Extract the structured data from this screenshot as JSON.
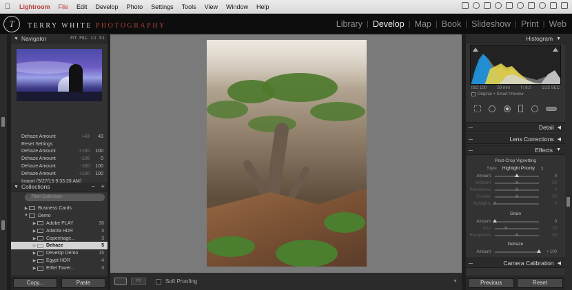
{
  "menubar": {
    "apple": "",
    "app": "Lightroom",
    "items": [
      "File",
      "Edit",
      "Develop",
      "Photo",
      "Settings",
      "Tools",
      "View",
      "Window",
      "Help"
    ]
  },
  "identity": {
    "logo": "T",
    "studio_name": "TERRY WHITE ",
    "studio_accent": "PHOTOGRAPHY"
  },
  "modules": [
    "Library",
    "Develop",
    "Map",
    "Book",
    "Slideshow",
    "Print",
    "Web"
  ],
  "active_module": "Develop",
  "navigator": {
    "title": "Navigator",
    "zoom_options": [
      "FIT",
      "FILL",
      "1:1",
      "3:1"
    ]
  },
  "history": [
    {
      "name": "Dehaze Amount",
      "a": "+43",
      "b": "43"
    },
    {
      "name": "Reset Settings",
      "a": "",
      "b": ""
    },
    {
      "name": "Dehaze Amount",
      "a": "+100",
      "b": "100"
    },
    {
      "name": "Dehaze Amount",
      "a": "-100",
      "b": "0"
    },
    {
      "name": "Dehaze Amount",
      "a": "-100",
      "b": "100"
    },
    {
      "name": "Dehaze Amount",
      "a": "+100",
      "b": "100"
    },
    {
      "name": "Import (5/27/15 9:33:28 AM)",
      "a": "",
      "b": ""
    }
  ],
  "collections": {
    "title": "Collections",
    "minus": "−",
    "plus": "+",
    "filter_placeholder": "Filter Collections",
    "items": [
      {
        "indent": 1,
        "name": "Business Cards",
        "count": "",
        "expanded": false,
        "selected": false
      },
      {
        "indent": 1,
        "name": "Demo",
        "count": "",
        "expanded": true,
        "selected": false
      },
      {
        "indent": 2,
        "name": "Adobe PLAY",
        "count": "36",
        "expanded": false,
        "selected": false
      },
      {
        "indent": 2,
        "name": "Atlanta HDR",
        "count": "3",
        "expanded": false,
        "selected": false
      },
      {
        "indent": 2,
        "name": "Copenhage...",
        "count": "3",
        "expanded": false,
        "selected": false
      },
      {
        "indent": 2,
        "name": "Dehaze",
        "count": "5",
        "expanded": false,
        "selected": true
      },
      {
        "indent": 2,
        "name": "Develop Demo",
        "count": "15",
        "expanded": false,
        "selected": false
      },
      {
        "indent": 2,
        "name": "Egypt HDR",
        "count": "4",
        "expanded": false,
        "selected": false
      },
      {
        "indent": 2,
        "name": "Eiffel Tower...",
        "count": "3",
        "expanded": false,
        "selected": false
      }
    ]
  },
  "left_buttons": {
    "copy": "Copy...",
    "paste": "Paste"
  },
  "toolbar": {
    "view_mode": "YY",
    "soft_proofing": "Soft Proofing"
  },
  "histogram": {
    "title": "Histogram",
    "iso": "ISO 100",
    "focal": "50 mm",
    "aperture": "f / 8.0",
    "shutter": "1/25 SEC",
    "preview": "Original + Smart Preview"
  },
  "sections": {
    "detail": "Detail",
    "lens": "Lens Corrections",
    "effects": "Effects",
    "camera": "Camera Calibration"
  },
  "effects": {
    "vignette_title": "Post-Crop Vignetting",
    "style_label": "Style",
    "style_value": "Highlight Priority",
    "vignette_sliders": [
      {
        "label": "Amount",
        "value": "0",
        "fraction": 0.5,
        "dim": false
      },
      {
        "label": "Midpoint",
        "value": "50",
        "fraction": 0.5,
        "dim": true
      },
      {
        "label": "Roundness",
        "value": "0",
        "fraction": 0.5,
        "dim": true
      },
      {
        "label": "Feather",
        "value": "50",
        "fraction": 0.5,
        "dim": true
      },
      {
        "label": "Highlights",
        "value": "0",
        "fraction": 0.0,
        "dim": true
      }
    ],
    "grain_title": "Grain",
    "grain_sliders": [
      {
        "label": "Amount",
        "value": "0",
        "fraction": 0.0,
        "dim": false
      },
      {
        "label": "Size",
        "value": "25",
        "fraction": 0.25,
        "dim": true
      },
      {
        "label": "Roughness",
        "value": "50",
        "fraction": 0.5,
        "dim": true
      }
    ],
    "dehaze_title": "Dehaze",
    "dehaze_slider": {
      "label": "Amount",
      "value": "+ 100",
      "fraction": 1.0,
      "dim": false
    }
  },
  "right_buttons": {
    "previous": "Previous",
    "reset": "Reset"
  },
  "colors": {
    "accent_red": "#b8403a",
    "panel": "#323232",
    "canvas": "#7a7a7a"
  }
}
